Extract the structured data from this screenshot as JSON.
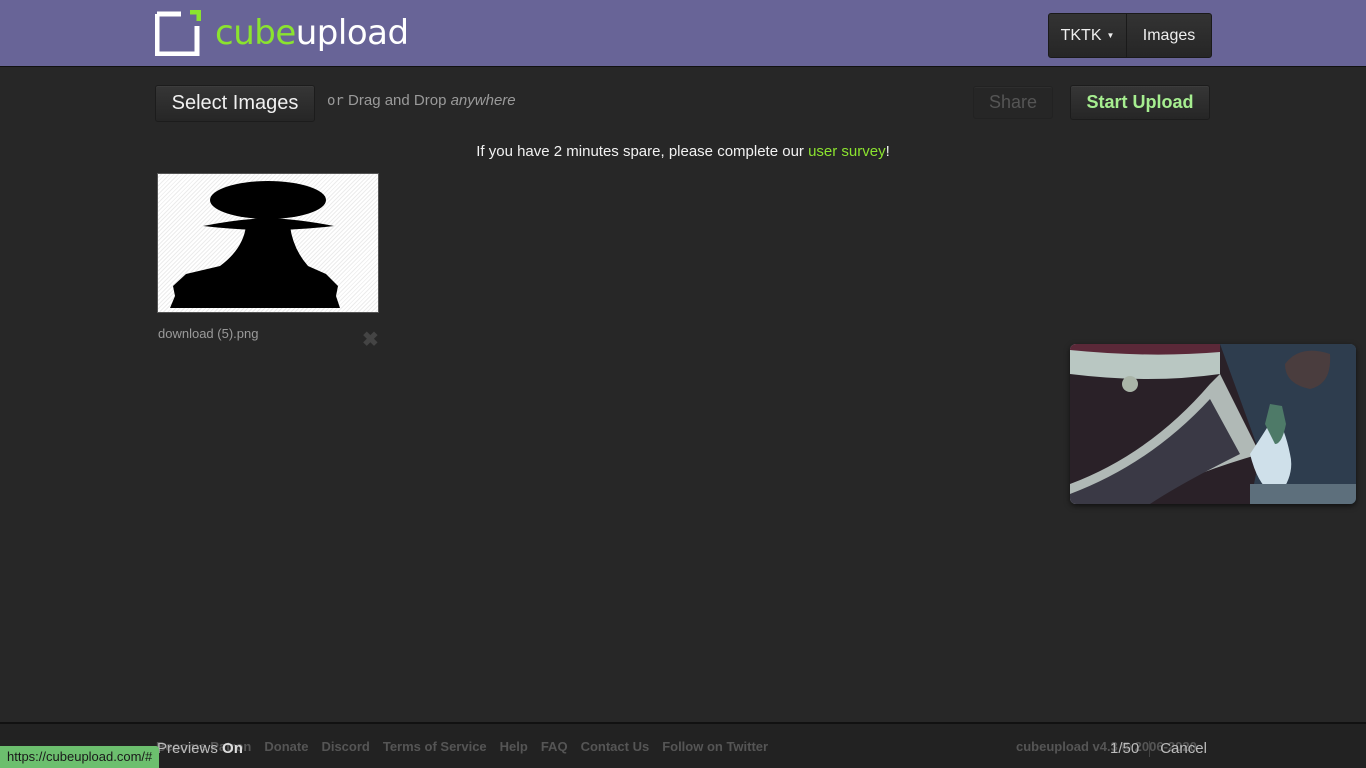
{
  "header": {
    "logo_part1": "cube",
    "logo_part2": "upload",
    "nav": {
      "user_label": "TKTK",
      "images_label": "Images"
    },
    "colors": {
      "bar": "#686497",
      "accent": "#8be32f"
    }
  },
  "toolbar": {
    "select_label": "Select Images",
    "or_label": "or",
    "dnd_label": "Drag and Drop",
    "dnd_emphasis": "anywhere",
    "share_label": "Share",
    "start_label": "Start Upload"
  },
  "survey": {
    "prefix": "If you have 2 minutes spare, please complete our ",
    "link_label": "user survey",
    "suffix": "!"
  },
  "files": [
    {
      "name": "download (5).png",
      "thumbnail": "chess-pawn-silhouette"
    }
  ],
  "preview_popup": {
    "image": "anime-screenshot"
  },
  "footer": {
    "links": [
      "Become Patron",
      "Donate",
      "Discord",
      "Terms of Service",
      "Help",
      "FAQ",
      "Contact Us",
      "Follow on Twitter"
    ],
    "copyright": "cubeupload v4.3 © 2006-2020",
    "previews_label": "Previews",
    "previews_state": "On",
    "counter": "1/50",
    "cancel_label": "Cancel"
  },
  "statusbar": {
    "url": "https://cubeupload.com/#"
  }
}
